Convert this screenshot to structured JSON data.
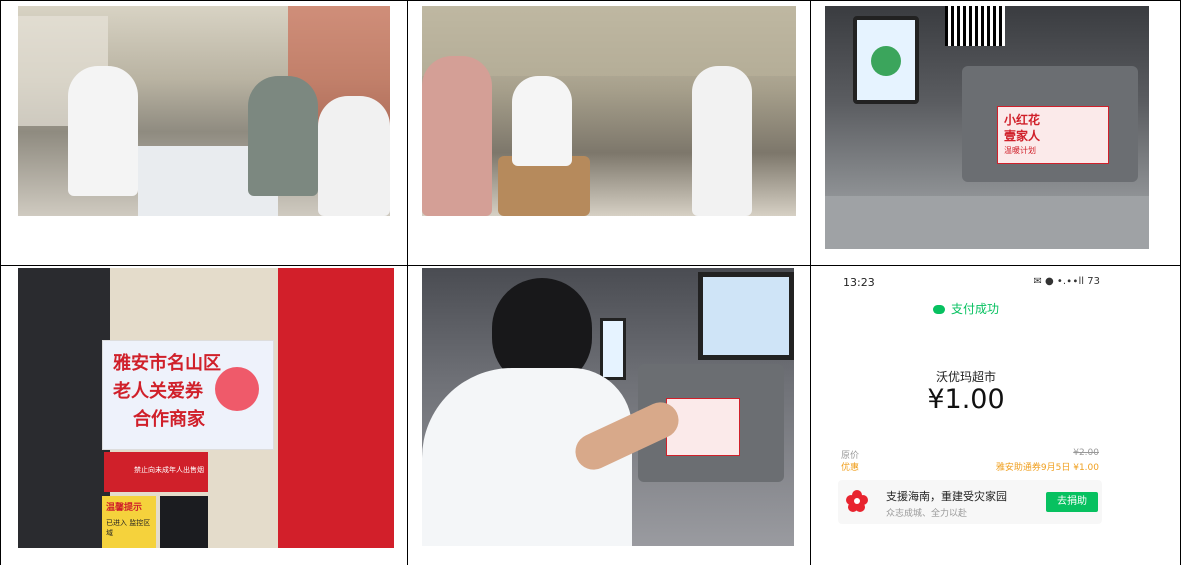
{
  "phone": {
    "time": "13:23",
    "status_icons": "✉ ● •.∙∙ll 73",
    "success": "支付成功",
    "merchant": "沃优玛超市",
    "amount": "¥1.00",
    "original_price_label": "原价",
    "original_price": "¥2.00",
    "discount_label": "优惠",
    "discount_value": "雅安助通券9月5日 ¥1.00",
    "donation_title": "支援海南，重建受灾家园",
    "donation_sub": "众志成城、全力以赴",
    "donation_button": "去捐助"
  },
  "poster": {
    "line1": "雅安市名山区",
    "line2": "老人关爱券",
    "line3": "合作商家",
    "notice": "禁止向未成年人出售烟酒",
    "tip": "温馨提示",
    "tip_sub": "已进入 监控区域"
  },
  "checkout_sign": {
    "line1": "小红花",
    "line2": "壹家人",
    "line3": "温暖计划"
  },
  "colors": {
    "wechat_green": "#07c160",
    "poster_red": "#d0202a",
    "discount_orange": "#f0a020"
  }
}
